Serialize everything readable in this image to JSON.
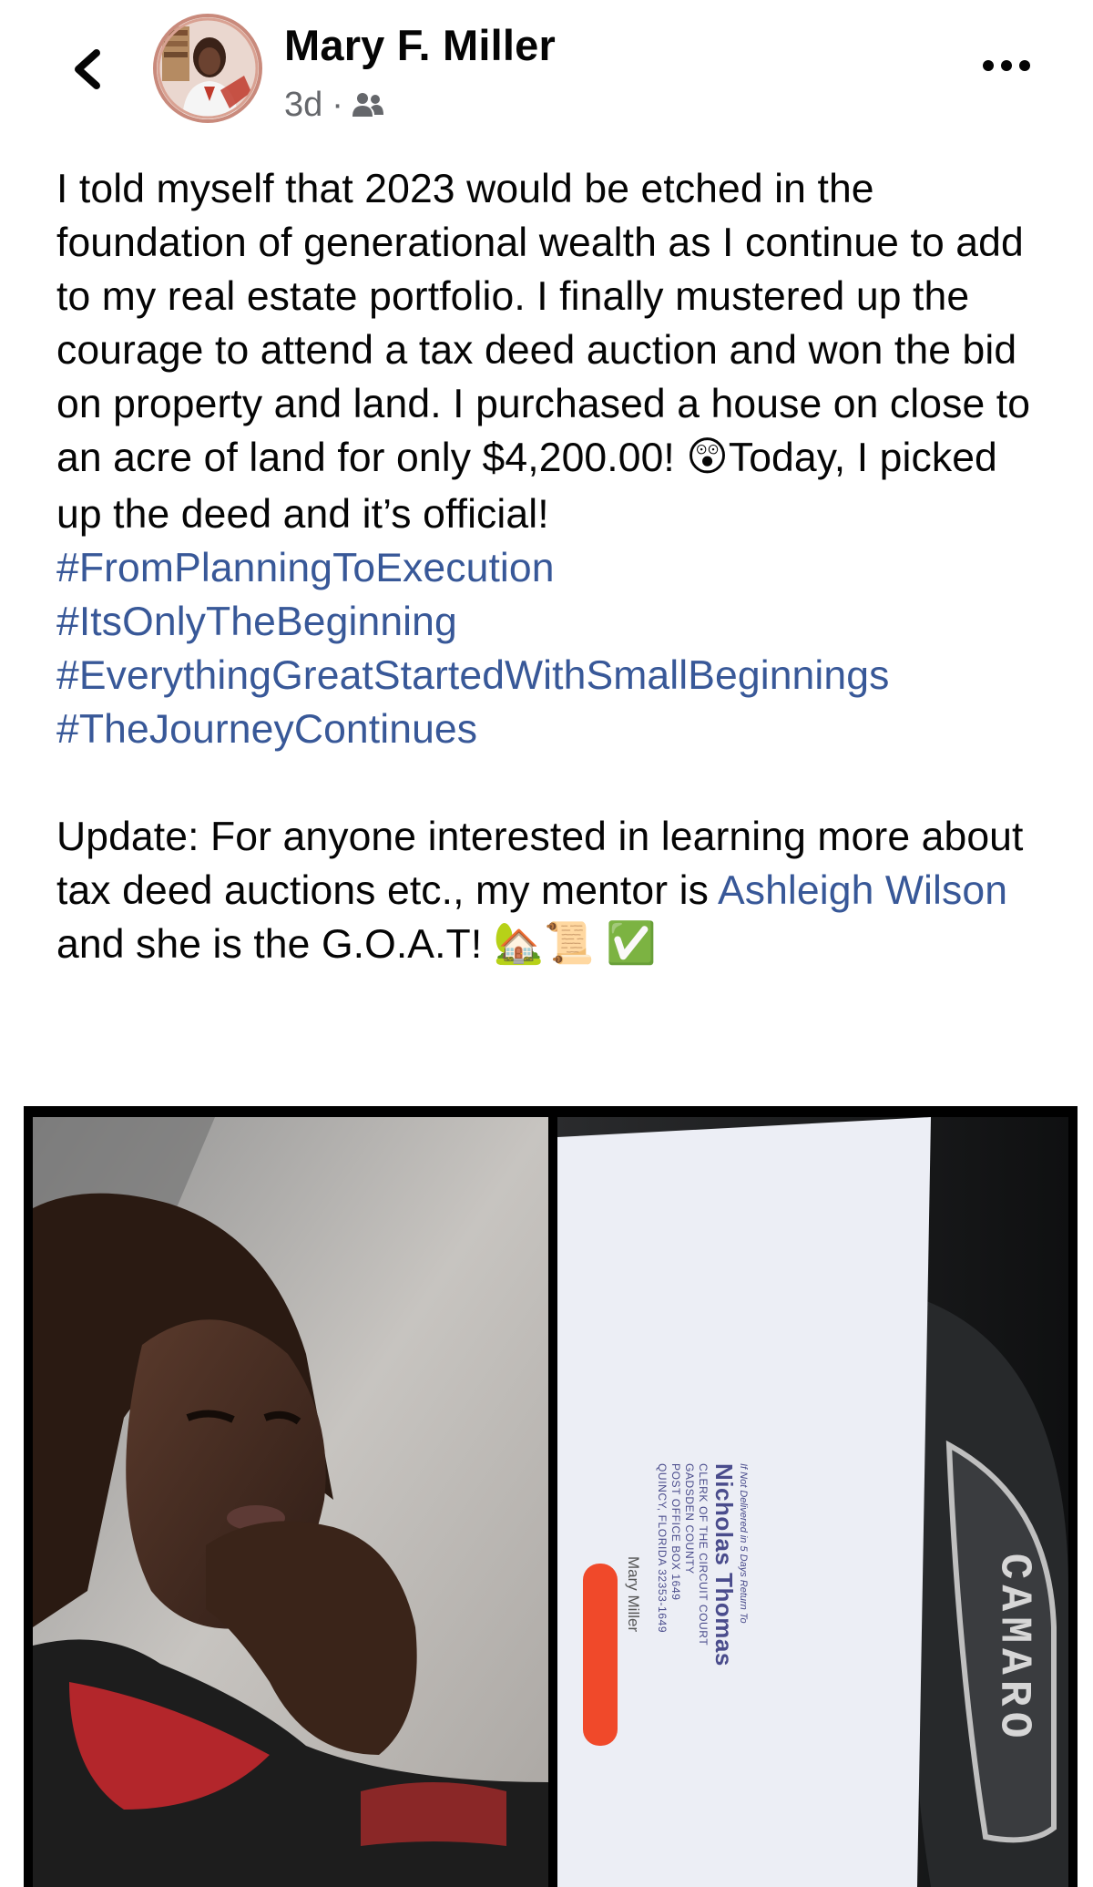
{
  "header": {
    "back_icon": "chevron-left-icon",
    "author_name": "Mary F. Miller",
    "time": "3d",
    "separator": "·",
    "audience_icon": "friends-icon",
    "more_icon": "more-horizontal-icon"
  },
  "post": {
    "paragraph1": "I told myself that 2023 would be etched in the foundation of generational wealth as I continue to add to my real estate portfolio. I finally mustered up the courage to attend a tax deed auction and won the bid on property and land. I purchased a house on close to an acre of land for only $4,200.00!",
    "emoji_astonished": "😲",
    "paragraph1_end": "Today, I picked up the deed and it’s official!",
    "hashtags": [
      "#FromPlanningToExecution",
      "#ItsOnlyTheBeginning",
      "#EverythingGreatStartedWithSmallBeginnings",
      "#TheJourneyContinues"
    ],
    "update_text": "Update: For anyone interested in learning more about tax deed auctions etc., my mentor is",
    "mention": "Ashleigh Wilson",
    "update_end": "and she is the G.O.A.T!",
    "emoji_house": "🏡",
    "emoji_scroll": "📜",
    "emoji_check": "✅"
  },
  "photos": {
    "envelope": {
      "return_note": "If Not Delivered in 5 Days Return To",
      "sender_name": "Nicholas Thomas",
      "address_lines": [
        "CLERK OF THE CIRCUIT COURT",
        "GADSDEN COUNTY",
        "POST OFFICE BOX 1649",
        "QUINCY, FLORIDA  32353-1649"
      ],
      "recipient": "Mary Miller"
    },
    "car_badge": "CAMARO"
  },
  "colors": {
    "link": "#385898",
    "secondary_text": "#65676b",
    "primary_text": "#050505",
    "redaction": "#f0492a",
    "envelope_ink": "#4a4c8c"
  }
}
